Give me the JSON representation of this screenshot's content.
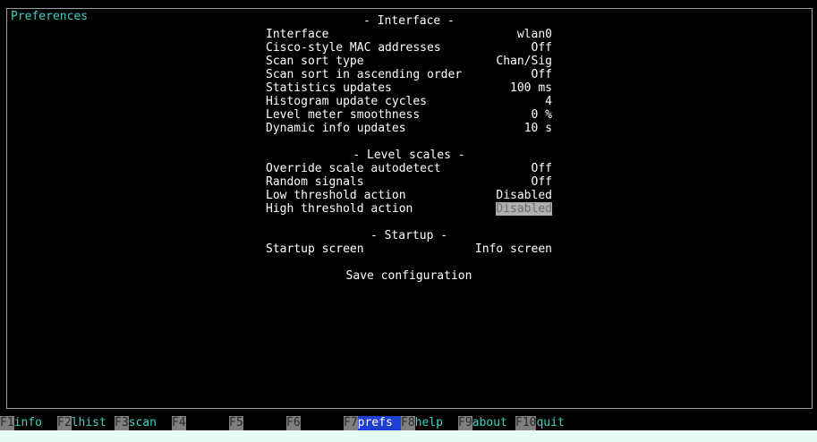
{
  "window": {
    "title": "Preferences"
  },
  "sections": {
    "interface": {
      "heading": "- Interface -",
      "rows": [
        {
          "label": "Interface",
          "value": "wlan0"
        },
        {
          "label": "Cisco-style MAC addresses",
          "value": "Off"
        },
        {
          "label": "Scan sort type",
          "value": "Chan/Sig"
        },
        {
          "label": "Scan sort in ascending order",
          "value": "Off"
        },
        {
          "label": "Statistics updates",
          "value": "100 ms"
        },
        {
          "label": "Histogram update cycles",
          "value": "4"
        },
        {
          "label": "Level meter smoothness",
          "value": "0 %"
        },
        {
          "label": "Dynamic info updates",
          "value": "10 s"
        }
      ]
    },
    "level_scales": {
      "heading": "- Level scales -",
      "rows": [
        {
          "label": "Override scale autodetect",
          "value": "Off"
        },
        {
          "label": "Random signals",
          "value": "Off"
        },
        {
          "label": "Low threshold action",
          "value": "Disabled"
        },
        {
          "label": "High threshold action",
          "value": "Disabled"
        }
      ]
    },
    "startup": {
      "heading": "- Startup -",
      "rows": [
        {
          "label": "Startup screen",
          "value": "Info screen"
        }
      ]
    }
  },
  "actions": {
    "save": "Save configuration"
  },
  "fkeys": [
    {
      "key": "F1",
      "label": "info"
    },
    {
      "key": "F2",
      "label": "lhist"
    },
    {
      "key": "F3",
      "label": "scan"
    },
    {
      "key": "F4",
      "label": ""
    },
    {
      "key": "F5",
      "label": ""
    },
    {
      "key": "F6",
      "label": ""
    },
    {
      "key": "F7",
      "label": "prefs"
    },
    {
      "key": "F8",
      "label": "help"
    },
    {
      "key": "F9",
      "label": "about"
    },
    {
      "key": "F10",
      "label": "quit"
    }
  ],
  "colors": {
    "accent": "#3fd0c0",
    "active_tab": "#1e3fd0",
    "selected_value_bg": "#b0b0b0"
  }
}
